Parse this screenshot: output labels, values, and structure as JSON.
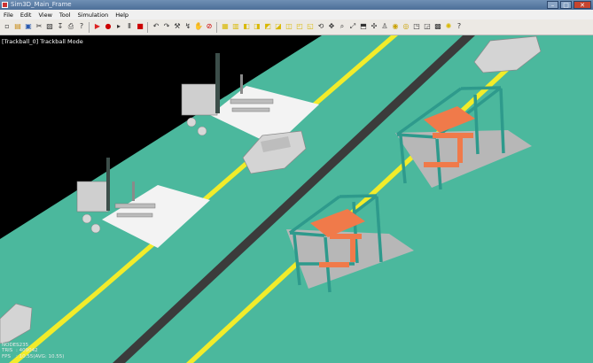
{
  "window": {
    "title": "Sim3D_Main_Frame",
    "min": "–",
    "max": "□",
    "close": "✕"
  },
  "menu": [
    "File",
    "Edit",
    "View",
    "Tool",
    "Simulation",
    "Help"
  ],
  "toolbar_icons": [
    "new-icon",
    "open-icon",
    "save-icon",
    "cut-icon",
    "paste-icon",
    "import-icon",
    "print-icon",
    "help-icon",
    "play-icon",
    "record-icon",
    "step-icon",
    "pause-icon",
    "stop-icon",
    "undo-icon",
    "redo-icon",
    "tool-icon",
    "pin-icon",
    "grab-icon",
    "no-icon",
    "shade-icon",
    "wire-icon",
    "cube-icon",
    "cube2-icon",
    "cube3-icon",
    "cube4-icon",
    "cube5-icon",
    "cube6-icon",
    "cube7-icon",
    "rotate-icon",
    "pan-icon",
    "zoom-icon",
    "fit-icon",
    "front-icon",
    "move-icon",
    "person-icon",
    "camera-a-icon",
    "camera-b-icon",
    "box-icon",
    "box2-icon",
    "grid-icon",
    "light-icon",
    "question-icon"
  ],
  "viewport": {
    "mode_label": "[Trackball_0] Trackball Mode"
  },
  "stats": [
    {
      "key": "NODES",
      "value": ": 235"
    },
    {
      "key": "TRIS",
      "value": ": 409042"
    },
    {
      "key": "FPS",
      "value": ": 10.55(AVG: 10.55)"
    }
  ]
}
